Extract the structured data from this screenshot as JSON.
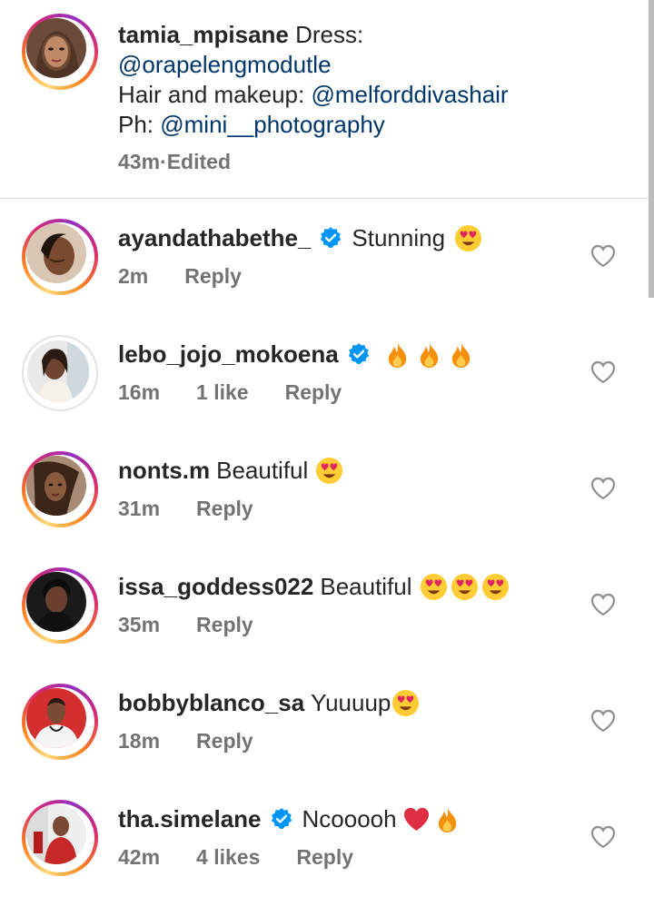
{
  "caption": {
    "username": "tamia_mpisane",
    "lead": " Dress:",
    "mention_dress": "@orapelengmodutle",
    "hair_label": "Hair and makeup: ",
    "mention_hair": "@melforddivashair",
    "ph_label": "Ph: ",
    "mention_ph": "@mini__photography",
    "time": "43m",
    "separator": " · ",
    "edited": "Edited"
  },
  "comments": [
    {
      "username": "ayandathabethe_",
      "verified": true,
      "text": "Stunning",
      "emojis": [
        "heart-eyes"
      ],
      "time": "2m",
      "likes": "",
      "reply": "Reply"
    },
    {
      "username": "lebo_jojo_mokoena",
      "verified": true,
      "text": "",
      "emojis": [
        "fire",
        "fire",
        "fire"
      ],
      "time": "16m",
      "likes": "1 like",
      "reply": "Reply"
    },
    {
      "username": "nonts.m",
      "verified": false,
      "text": "Beautiful",
      "emojis": [
        "heart-eyes"
      ],
      "time": "31m",
      "likes": "",
      "reply": "Reply"
    },
    {
      "username": "issa_goddess022",
      "verified": false,
      "text": "Beautiful",
      "emojis": [
        "heart-eyes",
        "heart-eyes",
        "heart-eyes"
      ],
      "time": "35m",
      "likes": "",
      "reply": "Reply"
    },
    {
      "username": "bobbyblanco_sa",
      "verified": false,
      "text": "Yuuuup",
      "emojis": [
        "heart-eyes"
      ],
      "time": "18m",
      "likes": "",
      "reply": "Reply"
    },
    {
      "username": "tha.simelane",
      "verified": true,
      "text": "Ncooooh",
      "emojis": [
        "red-heart",
        "fire"
      ],
      "time": "42m",
      "likes": "4 likes",
      "reply": "Reply"
    }
  ],
  "colors": {
    "text": "#262626",
    "secondary": "#737373",
    "mention": "#00376b",
    "verified": "#0095f6",
    "divider": "#dbdbdb"
  }
}
